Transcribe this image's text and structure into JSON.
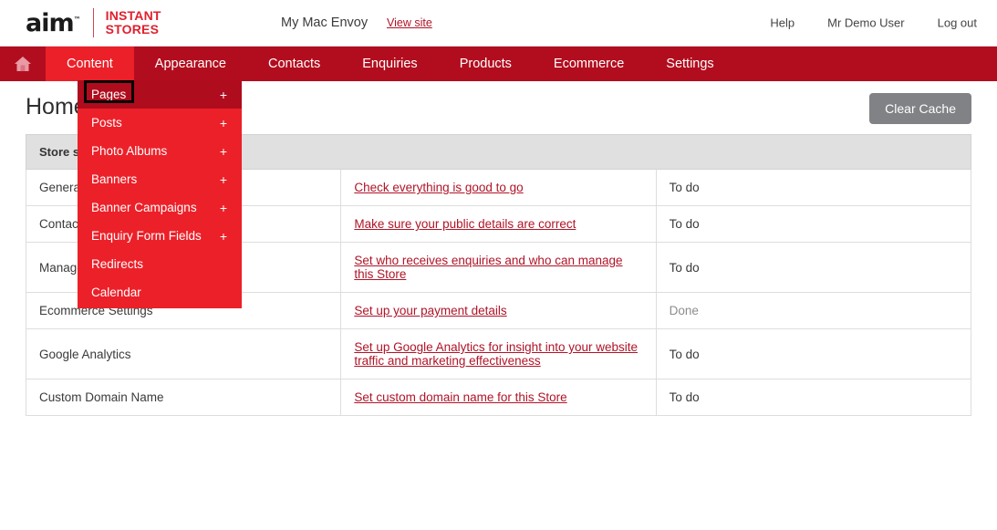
{
  "header": {
    "logo": {
      "mark": "aim",
      "mark_sup": "™",
      "line1": "INSTANT",
      "line2": "STORES"
    },
    "site_name": "My Mac Envoy",
    "view_site_label": "View site",
    "links": [
      {
        "label": "Help"
      },
      {
        "label": "Mr Demo User"
      },
      {
        "label": "Log out"
      }
    ]
  },
  "nav": {
    "home_icon": "home-icon",
    "items": [
      {
        "label": "Content",
        "active": true
      },
      {
        "label": "Appearance",
        "active": false
      },
      {
        "label": "Contacts",
        "active": false
      },
      {
        "label": "Enquiries",
        "active": false
      },
      {
        "label": "Products",
        "active": false
      },
      {
        "label": "Ecommerce",
        "active": false
      },
      {
        "label": "Settings",
        "active": false
      }
    ]
  },
  "dropdown": {
    "owner": "Content",
    "items": [
      {
        "label": "Pages",
        "expand": "+",
        "highlighted": true
      },
      {
        "label": "Posts",
        "expand": "+",
        "highlighted": false
      },
      {
        "label": "Photo Albums",
        "expand": "+",
        "highlighted": false
      },
      {
        "label": "Banners",
        "expand": "+",
        "highlighted": false
      },
      {
        "label": "Banner Campaigns",
        "expand": "+",
        "highlighted": false
      },
      {
        "label": "Enquiry Form Fields",
        "expand": "+",
        "highlighted": false
      },
      {
        "label": "Redirects",
        "expand": "",
        "highlighted": false
      },
      {
        "label": "Calendar",
        "expand": "",
        "highlighted": false
      }
    ]
  },
  "page": {
    "title": "Home",
    "clear_cache_label": "Clear Cache"
  },
  "table": {
    "header": "Store setup",
    "rows": [
      {
        "label": "General Settings",
        "link": "Check everything is good to go",
        "status": "To do"
      },
      {
        "label": "Contact Details",
        "link": "Make sure your public details are correct",
        "status": "To do"
      },
      {
        "label": "Manage Users",
        "link": "Set who receives enquiries and who can manage this Store",
        "status": "To do"
      },
      {
        "label": "Ecommerce Settings",
        "link": "Set up your payment details",
        "status": "Done"
      },
      {
        "label": "Google Analytics",
        "link": "Set up Google Analytics for insight into your website traffic and marketing effectiveness",
        "status": "To do"
      },
      {
        "label": "Custom Domain Name",
        "link": "Set custom domain name for this Store",
        "status": "To do"
      }
    ]
  },
  "colors": {
    "nav_dark_red": "#b20d1e",
    "accent_red": "#ec2029",
    "link_red": "#b01427",
    "button_gray": "#808285"
  }
}
